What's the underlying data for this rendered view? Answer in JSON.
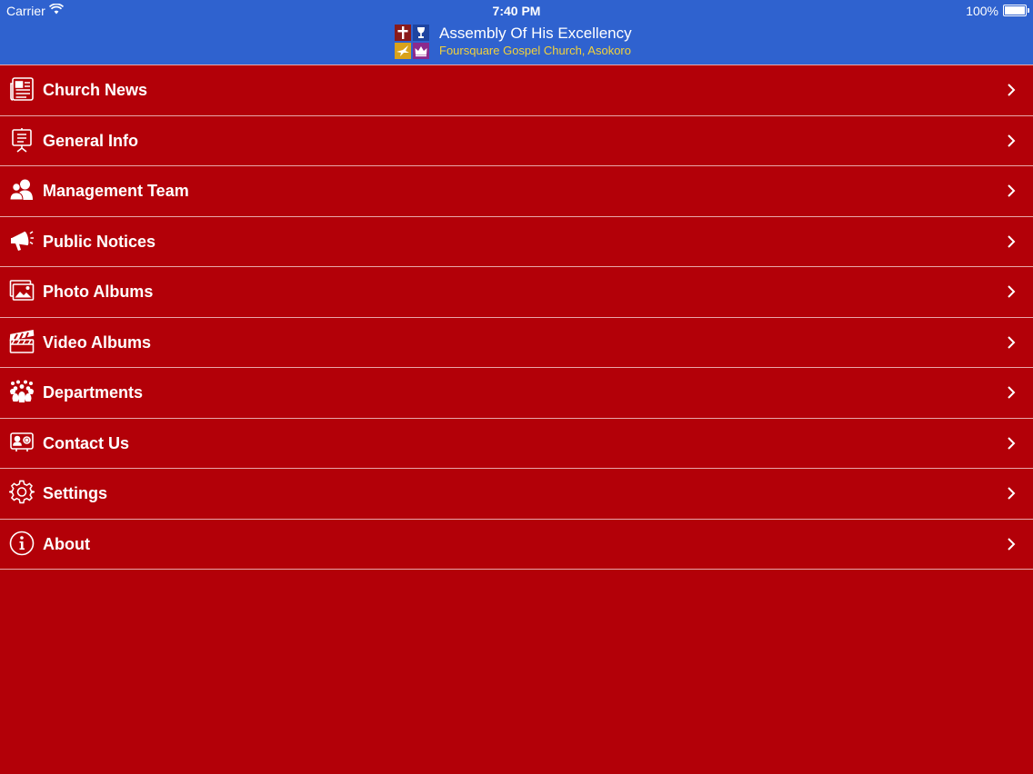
{
  "status_bar": {
    "carrier": "Carrier",
    "time": "7:40 PM",
    "battery": "100%"
  },
  "header": {
    "title": "Assembly Of His Excellency",
    "subtitle": "Foursquare Gospel Church, Asokoro",
    "title_color": "#ffffff",
    "subtitle_color": "#f2d23a",
    "bar_color": "#2f62cf"
  },
  "menu": {
    "background": "#b30008",
    "items": [
      {
        "label": "Church News",
        "icon": "newspaper-icon"
      },
      {
        "label": "General Info",
        "icon": "presentation-board-icon"
      },
      {
        "label": "Management Team",
        "icon": "people-icon"
      },
      {
        "label": "Public Notices",
        "icon": "megaphone-icon"
      },
      {
        "label": "Photo Albums",
        "icon": "photo-icon"
      },
      {
        "label": "Video Albums",
        "icon": "clapperboard-icon"
      },
      {
        "label": "Departments",
        "icon": "group-icon"
      },
      {
        "label": "Contact Us",
        "icon": "contact-card-icon"
      },
      {
        "label": "Settings",
        "icon": "gear-icon"
      },
      {
        "label": "About",
        "icon": "info-icon"
      }
    ]
  }
}
